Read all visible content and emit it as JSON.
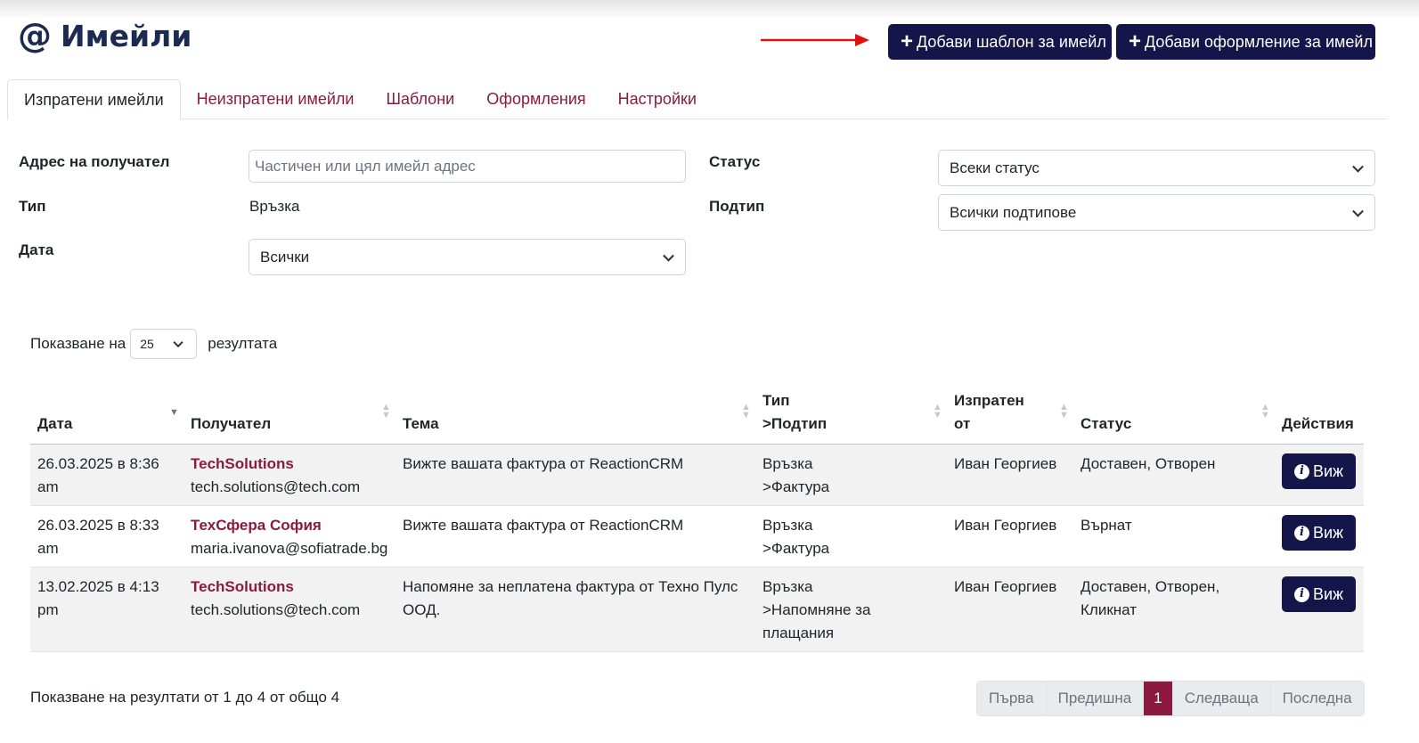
{
  "header": {
    "title": "Имейли",
    "add_template_label": "Добави шаблон за имейл",
    "add_design_label": "Добави оформление за имейл",
    "colors": {
      "primary": "#14164a",
      "accent": "#8b1a3e",
      "arrow": "#e01010"
    }
  },
  "tabs": [
    {
      "label": "Изпратени имейли",
      "active": true
    },
    {
      "label": "Неизпратени имейли"
    },
    {
      "label": "Шаблони"
    },
    {
      "label": "Оформления"
    },
    {
      "label": "Настройки"
    }
  ],
  "filters": {
    "recipient_label": "Адрес на получател",
    "recipient_placeholder": "Частичен или цял имейл адрес",
    "status_label": "Статус",
    "status_value": "Всеки статус",
    "type_label": "Тип",
    "type_value": "Връзка",
    "subtype_label": "Подтип",
    "subtype_value": "Всички подтипове",
    "date_label": "Дата",
    "date_value": "Всички"
  },
  "page_size": {
    "prefix": "Показване на",
    "value": "25",
    "suffix": "резултата"
  },
  "table": {
    "headers": {
      "date": "Дата",
      "recipient": "Получател",
      "subject": "Тема",
      "type_line1": "Тип",
      "type_line2": ">Подтип",
      "sender_line1": "Изпратен",
      "sender_line2": "от",
      "status": "Статус",
      "actions": "Действия"
    },
    "view_label": "Виж",
    "rows": [
      {
        "date_line1": "26.03.2025 в 8:36",
        "date_line2": "am",
        "name": "TechSolutions",
        "email": "tech.solutions@tech.com",
        "subject_line1": "Вижте вашата фактура от ReactionCRM",
        "subject_line2": "",
        "type_line1": "Връзка",
        "type_line2": ">Фактура",
        "type_line3": "",
        "sender": "Иван Георгиев",
        "status_line1": "Доставен, Отворен",
        "status_line2": ""
      },
      {
        "date_line1": "26.03.2025 в 8:33",
        "date_line2": "am",
        "name": "ТехСфера София",
        "email": "maria.ivanova@sofiatrade.bg",
        "subject_line1": "Вижте вашата фактура от ReactionCRM",
        "subject_line2": "",
        "type_line1": "Връзка",
        "type_line2": ">Фактура",
        "type_line3": "",
        "sender": "Иван Георгиев",
        "status_line1": "Върнат",
        "status_line2": ""
      },
      {
        "date_line1": "13.02.2025 в 4:13",
        "date_line2": "pm",
        "name": "TechSolutions",
        "email": "tech.solutions@tech.com",
        "subject_line1": "Напомяне за неплатена фактура от Техно Пулс",
        "subject_line2": "ООД.",
        "type_line1": "Връзка",
        "type_line2": ">Напомняне за",
        "type_line3": "плащания",
        "sender": "Иван Георгиев",
        "status_line1": "Доставен, Отворен,",
        "status_line2": "Кликнат"
      }
    ]
  },
  "footer": {
    "summary": "Показване на резултати от 1 до 4 от общо 4",
    "pagination": {
      "first": "Първа",
      "prev": "Предишна",
      "current": "1",
      "next": "Следваща",
      "last": "Последна"
    }
  }
}
